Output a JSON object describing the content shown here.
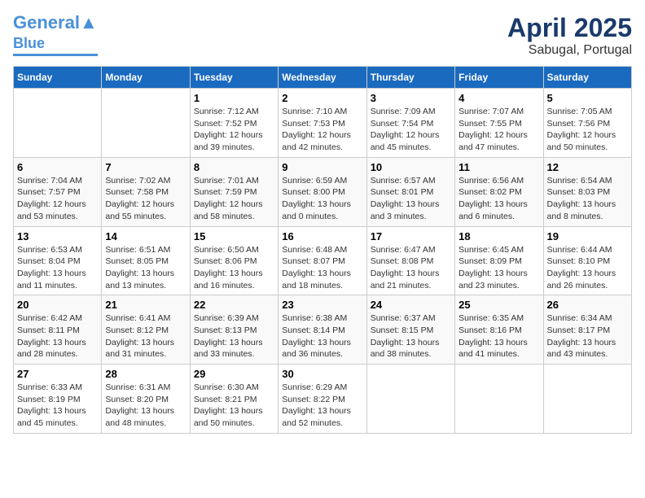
{
  "header": {
    "logo_line1": "General",
    "logo_line2": "Blue",
    "title": "April 2025",
    "location": "Sabugal, Portugal"
  },
  "columns": [
    "Sunday",
    "Monday",
    "Tuesday",
    "Wednesday",
    "Thursday",
    "Friday",
    "Saturday"
  ],
  "weeks": [
    [
      {
        "day": "",
        "info": ""
      },
      {
        "day": "",
        "info": ""
      },
      {
        "day": "1",
        "info": "Sunrise: 7:12 AM\nSunset: 7:52 PM\nDaylight: 12 hours and 39 minutes."
      },
      {
        "day": "2",
        "info": "Sunrise: 7:10 AM\nSunset: 7:53 PM\nDaylight: 12 hours and 42 minutes."
      },
      {
        "day": "3",
        "info": "Sunrise: 7:09 AM\nSunset: 7:54 PM\nDaylight: 12 hours and 45 minutes."
      },
      {
        "day": "4",
        "info": "Sunrise: 7:07 AM\nSunset: 7:55 PM\nDaylight: 12 hours and 47 minutes."
      },
      {
        "day": "5",
        "info": "Sunrise: 7:05 AM\nSunset: 7:56 PM\nDaylight: 12 hours and 50 minutes."
      }
    ],
    [
      {
        "day": "6",
        "info": "Sunrise: 7:04 AM\nSunset: 7:57 PM\nDaylight: 12 hours and 53 minutes."
      },
      {
        "day": "7",
        "info": "Sunrise: 7:02 AM\nSunset: 7:58 PM\nDaylight: 12 hours and 55 minutes."
      },
      {
        "day": "8",
        "info": "Sunrise: 7:01 AM\nSunset: 7:59 PM\nDaylight: 12 hours and 58 minutes."
      },
      {
        "day": "9",
        "info": "Sunrise: 6:59 AM\nSunset: 8:00 PM\nDaylight: 13 hours and 0 minutes."
      },
      {
        "day": "10",
        "info": "Sunrise: 6:57 AM\nSunset: 8:01 PM\nDaylight: 13 hours and 3 minutes."
      },
      {
        "day": "11",
        "info": "Sunrise: 6:56 AM\nSunset: 8:02 PM\nDaylight: 13 hours and 6 minutes."
      },
      {
        "day": "12",
        "info": "Sunrise: 6:54 AM\nSunset: 8:03 PM\nDaylight: 13 hours and 8 minutes."
      }
    ],
    [
      {
        "day": "13",
        "info": "Sunrise: 6:53 AM\nSunset: 8:04 PM\nDaylight: 13 hours and 11 minutes."
      },
      {
        "day": "14",
        "info": "Sunrise: 6:51 AM\nSunset: 8:05 PM\nDaylight: 13 hours and 13 minutes."
      },
      {
        "day": "15",
        "info": "Sunrise: 6:50 AM\nSunset: 8:06 PM\nDaylight: 13 hours and 16 minutes."
      },
      {
        "day": "16",
        "info": "Sunrise: 6:48 AM\nSunset: 8:07 PM\nDaylight: 13 hours and 18 minutes."
      },
      {
        "day": "17",
        "info": "Sunrise: 6:47 AM\nSunset: 8:08 PM\nDaylight: 13 hours and 21 minutes."
      },
      {
        "day": "18",
        "info": "Sunrise: 6:45 AM\nSunset: 8:09 PM\nDaylight: 13 hours and 23 minutes."
      },
      {
        "day": "19",
        "info": "Sunrise: 6:44 AM\nSunset: 8:10 PM\nDaylight: 13 hours and 26 minutes."
      }
    ],
    [
      {
        "day": "20",
        "info": "Sunrise: 6:42 AM\nSunset: 8:11 PM\nDaylight: 13 hours and 28 minutes."
      },
      {
        "day": "21",
        "info": "Sunrise: 6:41 AM\nSunset: 8:12 PM\nDaylight: 13 hours and 31 minutes."
      },
      {
        "day": "22",
        "info": "Sunrise: 6:39 AM\nSunset: 8:13 PM\nDaylight: 13 hours and 33 minutes."
      },
      {
        "day": "23",
        "info": "Sunrise: 6:38 AM\nSunset: 8:14 PM\nDaylight: 13 hours and 36 minutes."
      },
      {
        "day": "24",
        "info": "Sunrise: 6:37 AM\nSunset: 8:15 PM\nDaylight: 13 hours and 38 minutes."
      },
      {
        "day": "25",
        "info": "Sunrise: 6:35 AM\nSunset: 8:16 PM\nDaylight: 13 hours and 41 minutes."
      },
      {
        "day": "26",
        "info": "Sunrise: 6:34 AM\nSunset: 8:17 PM\nDaylight: 13 hours and 43 minutes."
      }
    ],
    [
      {
        "day": "27",
        "info": "Sunrise: 6:33 AM\nSunset: 8:19 PM\nDaylight: 13 hours and 45 minutes."
      },
      {
        "day": "28",
        "info": "Sunrise: 6:31 AM\nSunset: 8:20 PM\nDaylight: 13 hours and 48 minutes."
      },
      {
        "day": "29",
        "info": "Sunrise: 6:30 AM\nSunset: 8:21 PM\nDaylight: 13 hours and 50 minutes."
      },
      {
        "day": "30",
        "info": "Sunrise: 6:29 AM\nSunset: 8:22 PM\nDaylight: 13 hours and 52 minutes."
      },
      {
        "day": "",
        "info": ""
      },
      {
        "day": "",
        "info": ""
      },
      {
        "day": "",
        "info": ""
      }
    ]
  ]
}
